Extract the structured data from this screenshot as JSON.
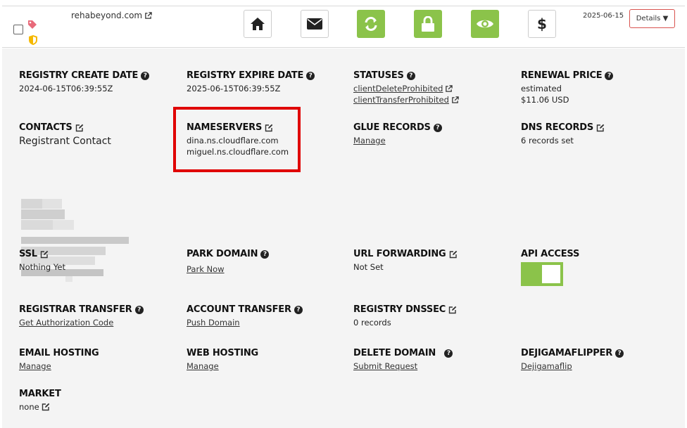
{
  "header": {
    "domain": "rehabeyond.com",
    "date": "2025-06-15",
    "details_label": "Details ▼",
    "buttons": [
      "home-icon",
      "mail-icon",
      "refresh-icon",
      "lock-icon",
      "eye-icon",
      "dollar-icon"
    ]
  },
  "registry_create": {
    "label": "REGISTRY CREATE DATE",
    "value": "2024-06-15T06:39:55Z"
  },
  "registry_expire": {
    "label": "REGISTRY EXPIRE DATE",
    "value": "2025-06-15T06:39:55Z"
  },
  "statuses": {
    "label": "STATUSES",
    "items": [
      "clientDeleteProhibited",
      "clientTransferProhibited"
    ]
  },
  "renewal": {
    "label": "RENEWAL PRICE",
    "line1": "estimated",
    "line2": "$11.06 USD"
  },
  "contacts": {
    "label": "CONTACTS",
    "value": "Registrant Contact"
  },
  "nameservers": {
    "label": "NAMESERVERS",
    "items": [
      "dina.ns.cloudflare.com",
      "miguel.ns.cloudflare.com"
    ]
  },
  "glue": {
    "label": "GLUE RECORDS",
    "link": "Manage"
  },
  "dns": {
    "label": "DNS RECORDS",
    "value": "6 records set"
  },
  "ssl": {
    "label": "SSL",
    "value": "Nothing Yet"
  },
  "park": {
    "label": "PARK DOMAIN",
    "link": "Park Now"
  },
  "url_fwd": {
    "label": "URL FORWARDING",
    "value": "Not Set"
  },
  "api": {
    "label": "API ACCESS",
    "enabled": true
  },
  "registrar_transfer": {
    "label": "REGISTRAR TRANSFER",
    "link": "Get Authorization Code"
  },
  "account_transfer": {
    "label": "ACCOUNT TRANSFER",
    "link": "Push Domain"
  },
  "dnssec": {
    "label": "REGISTRY DNSSEC",
    "value": "0 records"
  },
  "email": {
    "label": "EMAIL HOSTING",
    "link": "Manage"
  },
  "web": {
    "label": "WEB HOSTING",
    "link": "Manage"
  },
  "delete": {
    "label": "DELETE DOMAIN",
    "link": "Submit Request"
  },
  "dejigama": {
    "label": "DEJIGAMAFLIPPER",
    "link": "Dejigamaflip"
  },
  "market": {
    "label": "MARKET",
    "value": "none"
  },
  "colors": {
    "green": "#8bc34a",
    "highlight": "#e00000",
    "panel": "#f4f4f4"
  }
}
